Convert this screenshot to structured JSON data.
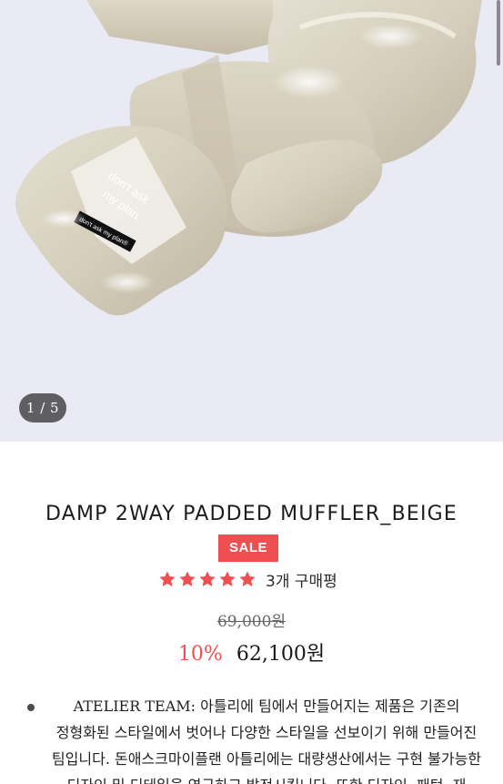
{
  "gallery": {
    "counter": "1 / 5",
    "image": {
      "tag_label": "don't ask my plan®",
      "print_text_line1": "don't ask",
      "print_text_line2": "my plan."
    }
  },
  "product": {
    "title": "DAMP 2WAY PADDED MUFFLER_BEIGE",
    "badge": "SALE",
    "rating": {
      "stars": 5,
      "review_count_label": "3개 구매평"
    },
    "original_price": "69,000원",
    "discount": "10%",
    "sale_price": "62,100원"
  },
  "description": {
    "text": "ATELIER TEAM: 아틀리에 팀에서 만들어지는 제품은 기존의 정형화된 스타일에서 벗어나 다양한 스타일을 선보이기 위해 만들어진 팀입니다. 돈애스크마이플랜 아틀리에는 대량생산에서는 구현 불가능한 디자인 및 디테일을 연구하고 발전시킵니다. 또한 디자인, 패턴, 재"
  },
  "colors": {
    "accent": "#ef4f50",
    "star": "#ef4f50",
    "hero_bg": "#e9eaf3",
    "fabric": "#d8d2c2",
    "counter_bg": "#5f5f62"
  }
}
